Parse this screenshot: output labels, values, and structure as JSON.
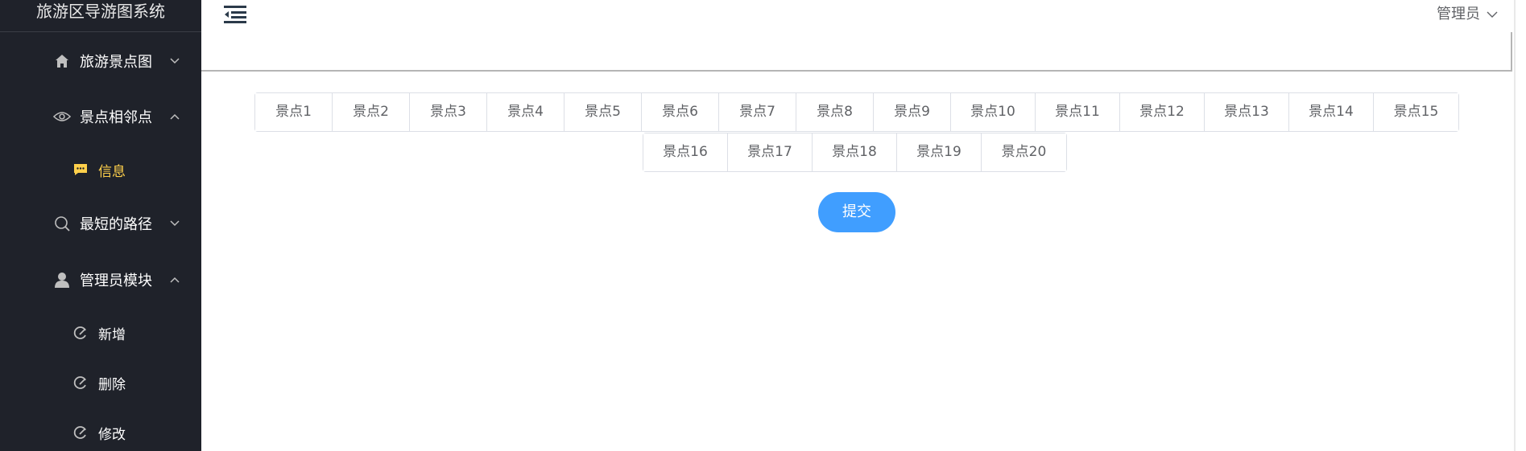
{
  "sidebar": {
    "title": "旅游区导游图系统",
    "menu": [
      {
        "label": "旅游景点图",
        "icon": "home-icon",
        "arrow": "down"
      },
      {
        "label": "景点相邻点",
        "icon": "eye-icon",
        "arrow": "up"
      },
      {
        "label": "最短的路径",
        "icon": "search-icon",
        "arrow": "down"
      },
      {
        "label": "管理员模块",
        "icon": "user-icon",
        "arrow": "up"
      }
    ],
    "submenu_info": {
      "label": "信息",
      "icon": "message-icon",
      "color": "#ffd04b"
    },
    "submenu_admin": [
      {
        "label": "新增",
        "icon": "edit-icon"
      },
      {
        "label": "删除",
        "icon": "edit-icon"
      },
      {
        "label": "修改",
        "icon": "edit-icon"
      }
    ],
    "background": "#1f222a"
  },
  "header": {
    "user": "管理员",
    "menu_icon": "hamburger-menu-icon"
  },
  "spots": {
    "row1": [
      "景点1",
      "景点2",
      "景点3",
      "景点4",
      "景点5",
      "景点6",
      "景点7",
      "景点8",
      "景点9",
      "景点10",
      "景点11",
      "景点12",
      "景点13",
      "景点14",
      "景点15"
    ],
    "row2": [
      "景点16",
      "景点17",
      "景点18",
      "景点19",
      "景点20"
    ]
  },
  "submit": {
    "label": "提交",
    "color": "#409eff"
  }
}
